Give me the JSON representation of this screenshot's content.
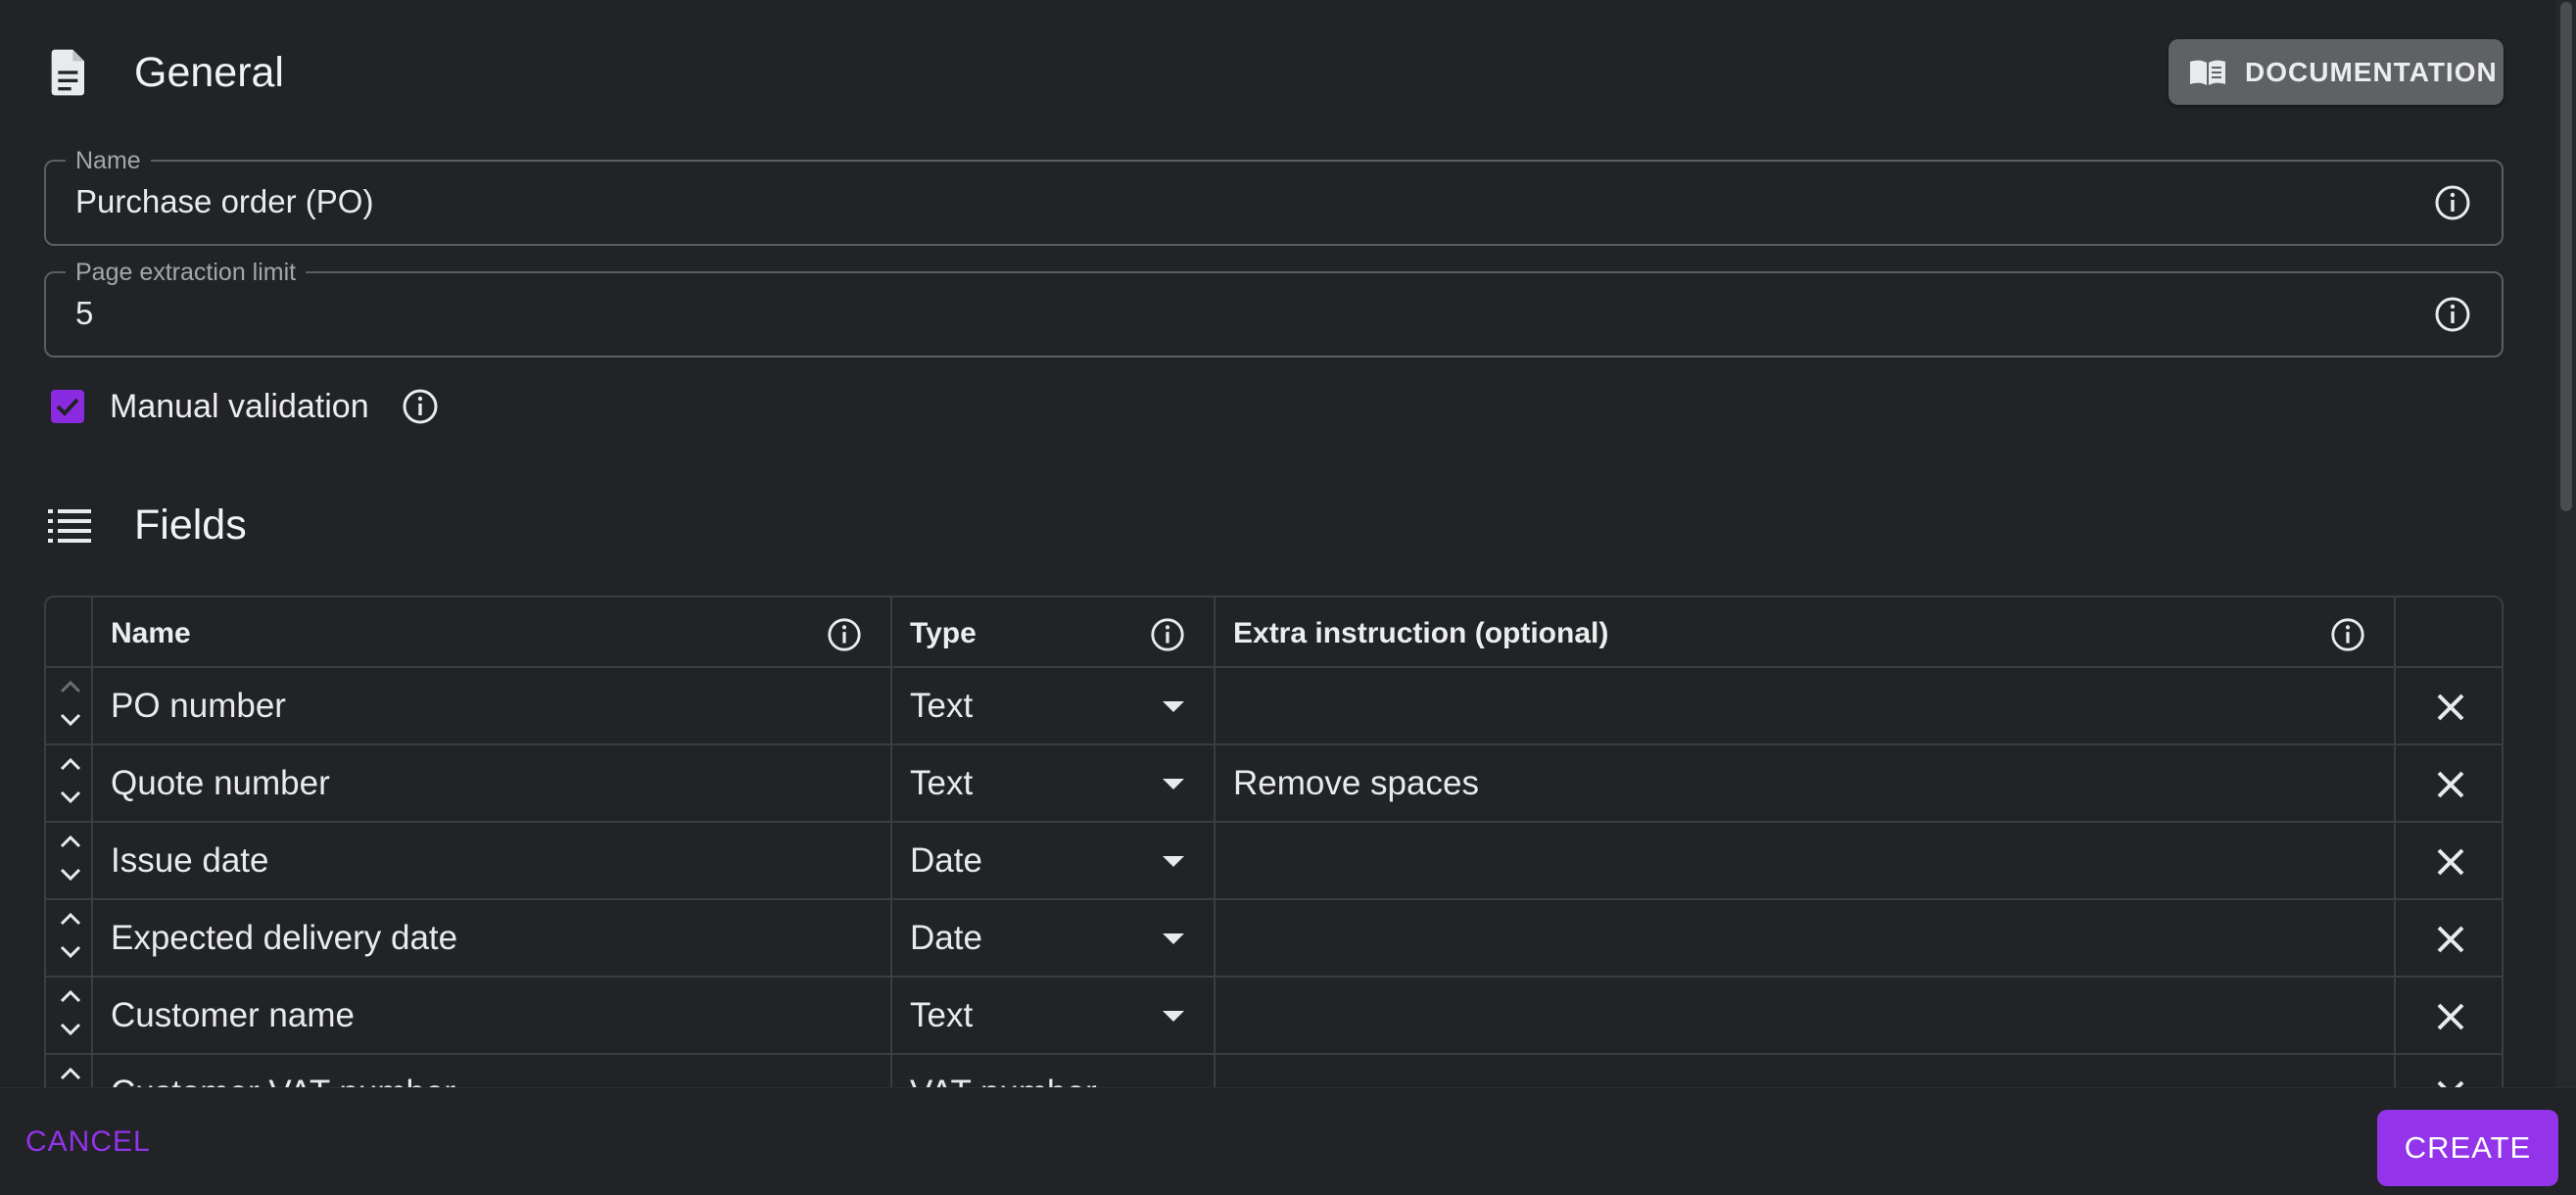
{
  "general": {
    "title": "General",
    "documentation_label": "DOCUMENTATION",
    "name_field": {
      "label": "Name",
      "value": "Purchase order (PO)"
    },
    "page_limit_field": {
      "label": "Page extraction limit",
      "value": "5"
    },
    "manual_validation": {
      "label": "Manual validation",
      "checked": true
    }
  },
  "fields": {
    "title": "Fields",
    "columns": [
      "Name",
      "Type",
      "Extra instruction (optional)"
    ],
    "rows": [
      {
        "name": "PO number",
        "type": "Text",
        "extra": ""
      },
      {
        "name": "Quote number",
        "type": "Text",
        "extra": "Remove spaces"
      },
      {
        "name": "Issue date",
        "type": "Date",
        "extra": ""
      },
      {
        "name": "Expected delivery date",
        "type": "Date",
        "extra": ""
      },
      {
        "name": "Customer name",
        "type": "Text",
        "extra": ""
      },
      {
        "name": "Customer VAT number",
        "type": "VAT number",
        "extra": ""
      }
    ]
  },
  "footer": {
    "cancel_label": "CANCEL",
    "create_label": "CREATE"
  },
  "colors": {
    "accent": "#9333ea",
    "background": "#212327",
    "documentation_button": "#5f6165"
  }
}
